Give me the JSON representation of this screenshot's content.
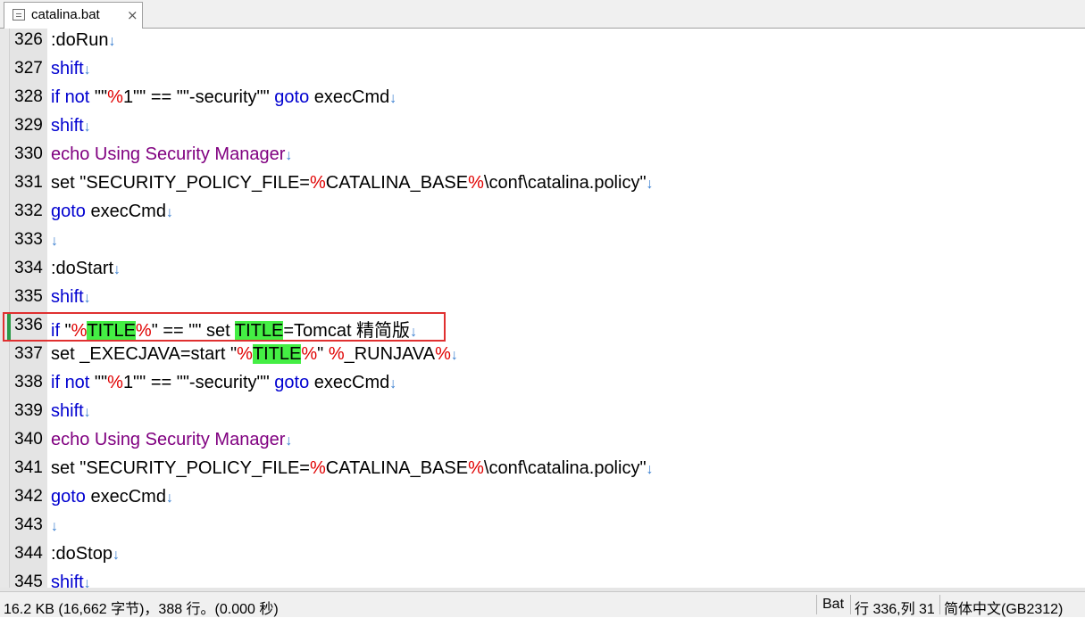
{
  "tab": {
    "title": "catalina.bat",
    "close_glyph": "×",
    "icon": "document-icon"
  },
  "lines": [
    {
      "n": "326",
      "tokens": [
        {
          "t": ":doRun"
        }
      ]
    },
    {
      "n": "327",
      "tokens": [
        {
          "t": "shift",
          "c": "kw"
        }
      ]
    },
    {
      "n": "328",
      "tokens": [
        {
          "t": "if",
          "c": "kw"
        },
        {
          "t": " "
        },
        {
          "t": "not",
          "c": "kw"
        },
        {
          "t": " \"\""
        },
        {
          "t": "%",
          "c": "pct"
        },
        {
          "t": "1\"\" == \"\"-security\"\" "
        },
        {
          "t": "goto",
          "c": "kw"
        },
        {
          "t": " execCmd"
        }
      ]
    },
    {
      "n": "329",
      "tokens": [
        {
          "t": "shift",
          "c": "kw"
        }
      ]
    },
    {
      "n": "330",
      "tokens": [
        {
          "t": "echo Using Security Manager",
          "c": "echo"
        }
      ]
    },
    {
      "n": "331",
      "tokens": [
        {
          "t": "set \"SECURITY_POLICY_FILE="
        },
        {
          "t": "%",
          "c": "pct"
        },
        {
          "t": "CATALINA_BASE"
        },
        {
          "t": "%",
          "c": "pct"
        },
        {
          "t": "\\conf\\catalina.policy\""
        }
      ]
    },
    {
      "n": "332",
      "tokens": [
        {
          "t": "goto",
          "c": "kw"
        },
        {
          "t": " execCmd"
        }
      ]
    },
    {
      "n": "333",
      "tokens": []
    },
    {
      "n": "334",
      "tokens": [
        {
          "t": ":doStart"
        }
      ]
    },
    {
      "n": "335",
      "tokens": [
        {
          "t": "shift",
          "c": "kw"
        }
      ]
    },
    {
      "n": "336",
      "tokens": [
        {
          "t": "if",
          "c": "kw"
        },
        {
          "t": " \""
        },
        {
          "t": "%",
          "c": "pct"
        },
        {
          "t": "TITLE",
          "c": "hl"
        },
        {
          "t": "%",
          "c": "pct"
        },
        {
          "t": "\" == \"\" set "
        },
        {
          "t": "TITLE",
          "c": "hl"
        },
        {
          "t": "=Tomcat 精简版"
        }
      ]
    },
    {
      "n": "337",
      "tokens": [
        {
          "t": "set _EXECJAVA=start \""
        },
        {
          "t": "%",
          "c": "pct"
        },
        {
          "t": "TITLE",
          "c": "hl"
        },
        {
          "t": "%",
          "c": "pct"
        },
        {
          "t": "\" "
        },
        {
          "t": "%",
          "c": "pct"
        },
        {
          "t": "_RUNJAVA"
        },
        {
          "t": "%",
          "c": "pct"
        }
      ]
    },
    {
      "n": "338",
      "tokens": [
        {
          "t": "if",
          "c": "kw"
        },
        {
          "t": " "
        },
        {
          "t": "not",
          "c": "kw"
        },
        {
          "t": " \"\""
        },
        {
          "t": "%",
          "c": "pct"
        },
        {
          "t": "1\"\" == \"\"-security\"\" "
        },
        {
          "t": "goto",
          "c": "kw"
        },
        {
          "t": " execCmd"
        }
      ]
    },
    {
      "n": "339",
      "tokens": [
        {
          "t": "shift",
          "c": "kw"
        }
      ]
    },
    {
      "n": "340",
      "tokens": [
        {
          "t": "echo Using Security Manager",
          "c": "echo"
        }
      ]
    },
    {
      "n": "341",
      "tokens": [
        {
          "t": "set \"SECURITY_POLICY_FILE="
        },
        {
          "t": "%",
          "c": "pct"
        },
        {
          "t": "CATALINA_BASE"
        },
        {
          "t": "%",
          "c": "pct"
        },
        {
          "t": "\\conf\\catalina.policy\""
        }
      ]
    },
    {
      "n": "342",
      "tokens": [
        {
          "t": "goto",
          "c": "kw"
        },
        {
          "t": " execCmd"
        }
      ]
    },
    {
      "n": "343",
      "tokens": []
    },
    {
      "n": "344",
      "tokens": [
        {
          "t": ":doStop"
        }
      ]
    },
    {
      "n": "345",
      "tokens": [
        {
          "t": "shift",
          "c": "kw"
        }
      ]
    }
  ],
  "eol_glyph": "↓",
  "current_line": "336",
  "status": {
    "file_info": "16.2 KB (16,662 字节)，388 行。(0.000 秒)",
    "language": "Bat",
    "position": "行 336,列 31",
    "encoding": "简体中文(GB2312)"
  },
  "colors": {
    "keyword": "#0000d0",
    "echo": "#800080",
    "percent": "#e00000",
    "match_highlight": "#44ee44",
    "eol_mark": "#3a7fd0",
    "annotation_box": "#e03030",
    "current_line_marker": "#2a9a48"
  }
}
